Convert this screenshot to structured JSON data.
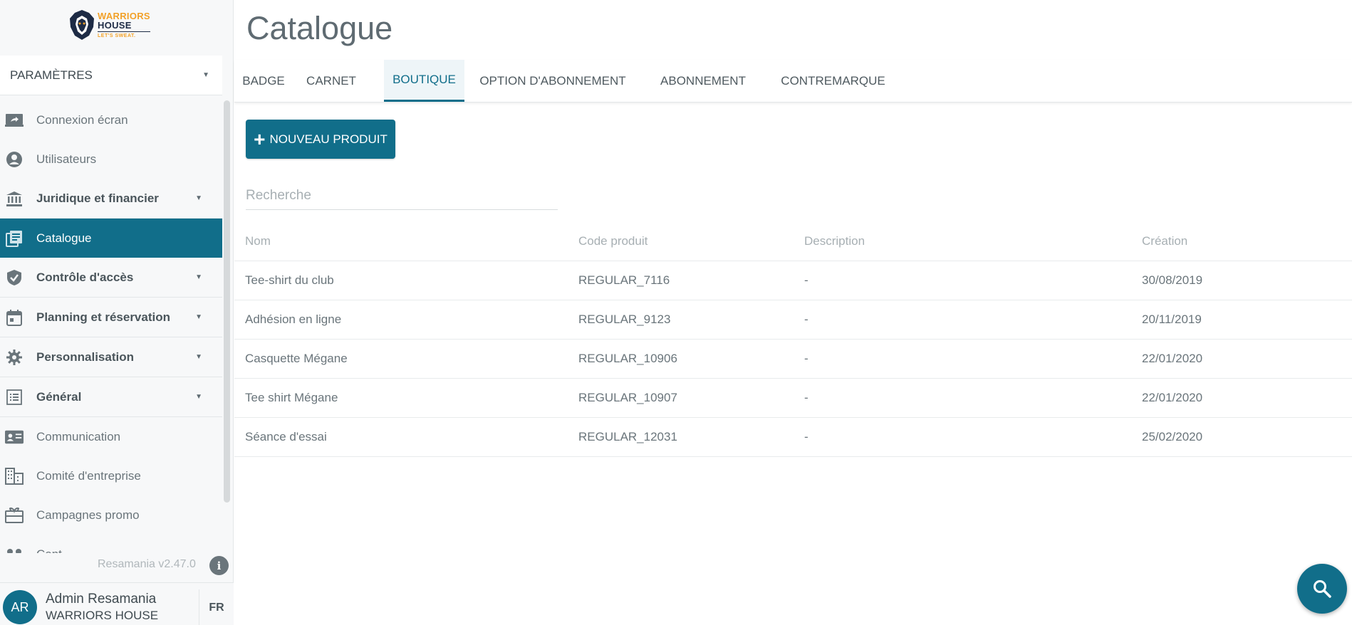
{
  "brand": {
    "logo_line1": "WARRIORS",
    "logo_line2": "HOUSE",
    "logo_tagline": "LET'S SWEAT."
  },
  "sidebar": {
    "section_select": "PARAMÈTRES",
    "items": [
      {
        "label": "Connexion écran",
        "icon": "screen-share-icon",
        "type": "link"
      },
      {
        "label": "Utilisateurs",
        "icon": "user-circle-icon",
        "type": "link"
      },
      {
        "label": "Juridique et financier",
        "icon": "bank-icon",
        "type": "group"
      },
      {
        "label": "Catalogue",
        "icon": "catalogue-icon",
        "type": "active"
      },
      {
        "label": "Contrôle d'accès",
        "icon": "shield-check-icon",
        "type": "group"
      },
      {
        "label": "Planning et réservation",
        "icon": "calendar-icon",
        "type": "group"
      },
      {
        "label": "Personnalisation",
        "icon": "gear-icon",
        "type": "group"
      },
      {
        "label": "Général",
        "icon": "list-icon",
        "type": "group"
      },
      {
        "label": "Communication",
        "icon": "contact-card-icon",
        "type": "link"
      },
      {
        "label": "Comité d'entreprise",
        "icon": "building-icon",
        "type": "link"
      },
      {
        "label": "Campagnes promo",
        "icon": "gift-card-icon",
        "type": "link"
      },
      {
        "label": "Cont...",
        "icon": "people-icon",
        "type": "link"
      }
    ],
    "version": "Resamania v2.47.0",
    "info_icon": "info-icon",
    "user": {
      "initials": "AR",
      "name": "Admin Resamania",
      "club": "WARRIORS HOUSE",
      "language": "FR"
    }
  },
  "main": {
    "title": "Catalogue",
    "tabs": [
      {
        "label": "BADGE",
        "active": false
      },
      {
        "label": "CARNET",
        "active": false
      },
      {
        "label": "BOUTIQUE",
        "active": true
      },
      {
        "label": "OPTION D'ABONNEMENT",
        "active": false
      },
      {
        "label": "ABONNEMENT",
        "active": false
      },
      {
        "label": "CONTREMARQUE",
        "active": false
      }
    ],
    "new_button_label": "NOUVEAU PRODUIT",
    "search_placeholder": "Recherche",
    "table": {
      "columns": [
        "Nom",
        "Code produit",
        "Description",
        "Création"
      ],
      "rows": [
        [
          "Tee-shirt du club",
          "REGULAR_7116",
          "-",
          "30/08/2019"
        ],
        [
          "Adhésion en ligne",
          "REGULAR_9123",
          "-",
          "20/11/2019"
        ],
        [
          "Casquette Mégane",
          "REGULAR_10906",
          "-",
          "22/01/2020"
        ],
        [
          "Tee shirt Mégane",
          "REGULAR_10907",
          "-",
          "22/01/2020"
        ],
        [
          "Séance d'essai",
          "REGULAR_12031",
          "-",
          "25/02/2020"
        ]
      ]
    }
  },
  "colors": {
    "accent": "#116e8a",
    "logo_orange": "#f2a128",
    "logo_navy": "#1d2b45"
  }
}
